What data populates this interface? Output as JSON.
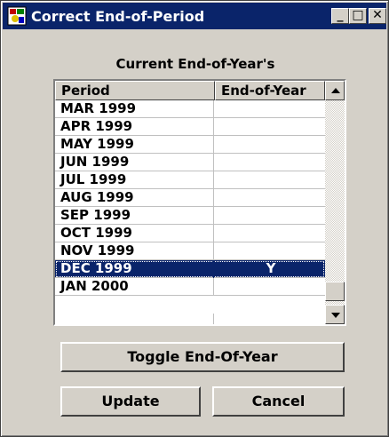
{
  "window": {
    "title": "Correct End-of-Period",
    "minimize_glyph": "_",
    "maximize_glyph": "□",
    "close_glyph": "✕"
  },
  "label": "Current End-of-Year's",
  "grid": {
    "columns": [
      "Period",
      "End-of-Year"
    ],
    "rows": [
      {
        "period": "MAR 1999",
        "eoy": ""
      },
      {
        "period": "APR 1999",
        "eoy": ""
      },
      {
        "period": "MAY 1999",
        "eoy": ""
      },
      {
        "period": "JUN 1999",
        "eoy": ""
      },
      {
        "period": "JUL 1999",
        "eoy": ""
      },
      {
        "period": "AUG 1999",
        "eoy": ""
      },
      {
        "period": "SEP 1999",
        "eoy": ""
      },
      {
        "period": "OCT 1999",
        "eoy": ""
      },
      {
        "period": "NOV 1999",
        "eoy": ""
      },
      {
        "period": "DEC 1999",
        "eoy": "Y",
        "selected": true
      },
      {
        "period": "JAN 2000",
        "eoy": ""
      }
    ]
  },
  "buttons": {
    "toggle": "Toggle End-Of-Year",
    "update": "Update",
    "cancel": "Cancel"
  },
  "colors": {
    "titlebar": "#0a246a",
    "face": "#d4d0c8",
    "selection": "#0a246a"
  },
  "icons": {
    "app": "app-icon",
    "scroll_up": "arrow-up-icon",
    "scroll_down": "arrow-down-icon"
  }
}
